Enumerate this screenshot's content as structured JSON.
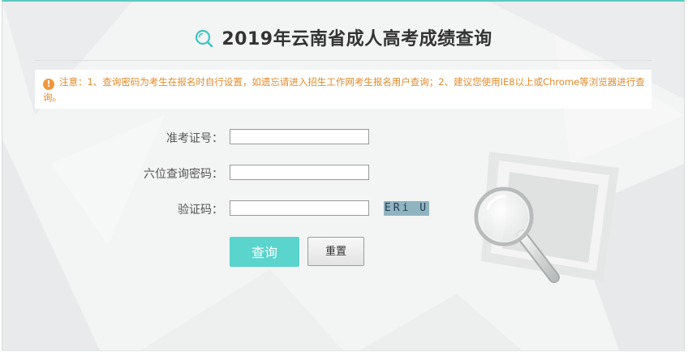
{
  "page": {
    "title": "2019年云南省成人高考成绩查询",
    "title_icon": "magnifier-icon",
    "notice": "注意：1、查询密码为考生在报名时自行设置，如遗忘请进入招生工作网考生报名用户查询；2、建议您使用IE8以上或Chrome等浏览器进行查询。",
    "notice_icon": "!"
  },
  "form": {
    "exam_number": {
      "label": "准考证号：",
      "value": "",
      "placeholder": ""
    },
    "password": {
      "label": "六位查询密码：",
      "value": "",
      "placeholder": ""
    },
    "captcha": {
      "label": "验证码：",
      "value": "",
      "placeholder": "",
      "image_text": "ERi U"
    }
  },
  "buttons": {
    "query": "查询",
    "reset": "重置"
  },
  "colors": {
    "accent": "#5ad4cd",
    "notice_text": "#e38a2a",
    "top_border": "#5cc9c0",
    "captcha_bg": "#8fb5c0"
  }
}
